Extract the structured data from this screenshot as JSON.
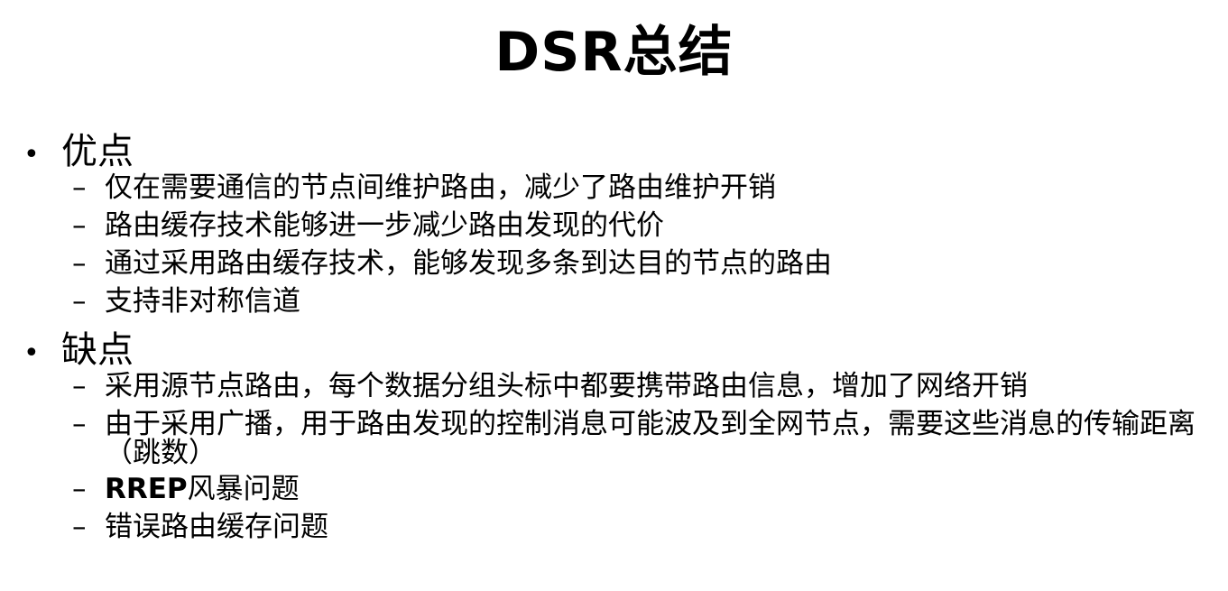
{
  "title": "DSR总结",
  "pros": {
    "heading": "优点",
    "items": [
      "仅在需要通信的节点间维护路由，减少了路由维护开销",
      "路由缓存技术能够进一步减少路由发现的代价",
      "通过采用路由缓存技术，能够发现多条到达目的节点的路由",
      "支持非对称信道"
    ]
  },
  "cons": {
    "heading": "缺点",
    "items": [
      "采用源节点路由，每个数据分组头标中都要携带路由信息，增加了网络开销",
      "由于采用广播，用于路由发现的控制消息可能波及到全网节点，需要这些消息的传输距离（跳数）",
      "风暴问题",
      "错误路由缓存问题"
    ],
    "rrep_prefix": "RREP"
  },
  "bullet_symbol": "•",
  "dash_symbol": "–"
}
